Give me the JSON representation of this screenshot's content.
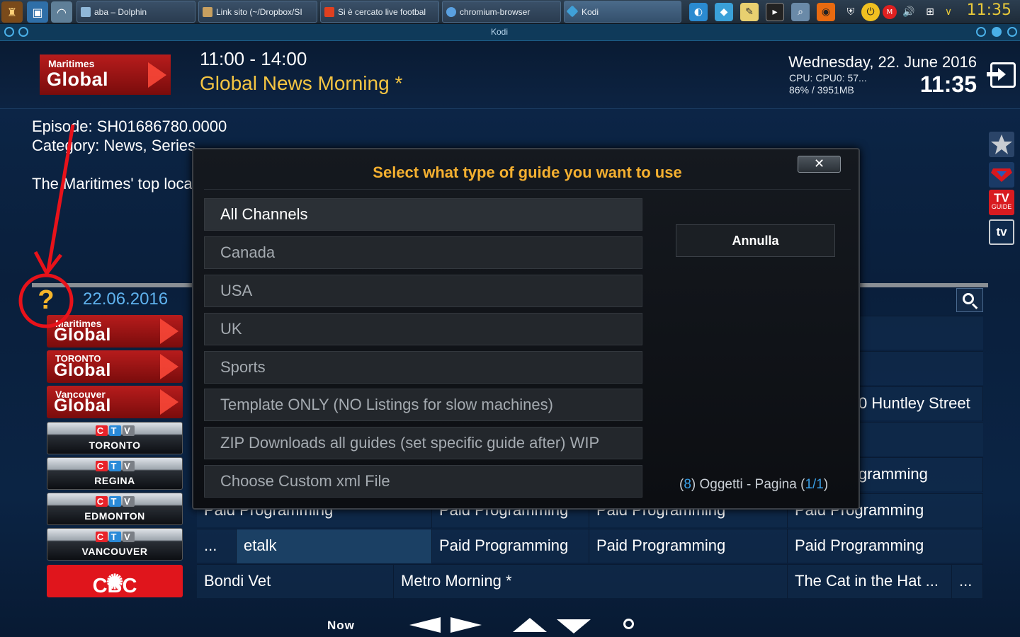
{
  "taskbar": {
    "tasks": [
      {
        "label": "aba – Dolphin"
      },
      {
        "label": "Link sito (~/Dropbox/SI"
      },
      {
        "label": "Si è cercato live footbal"
      },
      {
        "label": "chromium-browser"
      },
      {
        "label": "Kodi"
      }
    ],
    "clock": "11:35",
    "tray_icons": [
      "display-icon",
      "kodi-icon",
      "notes-icon",
      "terminal-icon",
      "search-tool-icon",
      "webcam-icon",
      "shield-icon",
      "power-icon",
      "mail-icon",
      "volume-icon",
      "network-icon",
      "chevron-down-icon"
    ]
  },
  "window": {
    "title": "Kodi"
  },
  "header": {
    "channel_logo": {
      "top": "Maritimes",
      "bottom": "Global"
    },
    "time_range": "11:00 - 14:00",
    "show_title": "Global News Morning *",
    "date": "Wednesday, 22. June 2016",
    "cpu_line1": "CPU: CPU0:  57...",
    "cpu_line2": "86% / 3951MB",
    "clock": "11:35"
  },
  "info": {
    "episode": "Episode: SH01686780.0000",
    "category": "Category: News, Series",
    "description": "The Maritimes' top loca"
  },
  "side_icons": [
    "star-icon",
    "superman-icon",
    "tv-guide-icon",
    "tv-icon"
  ],
  "side_tvguide_text": {
    "top": "TV",
    "bottom": "GUIDE"
  },
  "side_tv_text": "tv",
  "guide": {
    "date": "22.06.2016",
    "channels": [
      {
        "type": "global",
        "top": "Maritimes",
        "bottom": "Global"
      },
      {
        "type": "global",
        "top": "TORONTO",
        "bottom": "Global"
      },
      {
        "type": "global",
        "top": "Vancouver",
        "bottom": "Global"
      },
      {
        "type": "ctv",
        "city": "TORONTO"
      },
      {
        "type": "ctv",
        "city": "REGINA"
      },
      {
        "type": "ctv",
        "city": "EDMONTON"
      },
      {
        "type": "ctv",
        "city": "VANCOUVER"
      },
      {
        "type": "cbc",
        "name": "CBC"
      }
    ],
    "ctv_letters": [
      "C",
      "T",
      "V"
    ],
    "rows": [
      {
        "cells": [
          "0 Huntley Street"
        ]
      },
      {
        "cells": [
          "gramming"
        ]
      },
      {
        "cells": [
          "Paid Programming",
          "Paid Programming",
          "Paid Programming",
          "Paid Programming"
        ]
      },
      {
        "cells": [
          "...",
          "etalk",
          "Paid Programming",
          "Paid Programming",
          "Paid Programming"
        ]
      },
      {
        "cells": [
          "Bondi Vet",
          "Metro Morning *",
          "The Cat in the Hat ...",
          "..."
        ]
      }
    ]
  },
  "bottom_nav": {
    "now_label": "Now"
  },
  "dialog": {
    "title": "Select what type of guide you want to use",
    "close_label": "✕",
    "options": [
      "All Channels",
      "Canada",
      "USA",
      "UK",
      "Sports",
      "Template ONLY (NO Listings for slow machines)",
      "ZIP  Downloads all guides (set specific guide after) WIP",
      "Choose Custom xml File"
    ],
    "cancel_label": "Annulla",
    "count": {
      "open1": "(",
      "items": "8",
      "text": ") Oggetti - Pagina (",
      "page": "1/1",
      "close": ")"
    }
  },
  "colors": {
    "accent_orange": "#f5b030",
    "title_yellow": "#f5c542",
    "date_blue": "#5fb2ee",
    "annotation_red": "#e8121a",
    "global_red": "#b71c1c",
    "cbc_red": "#e0151c"
  }
}
